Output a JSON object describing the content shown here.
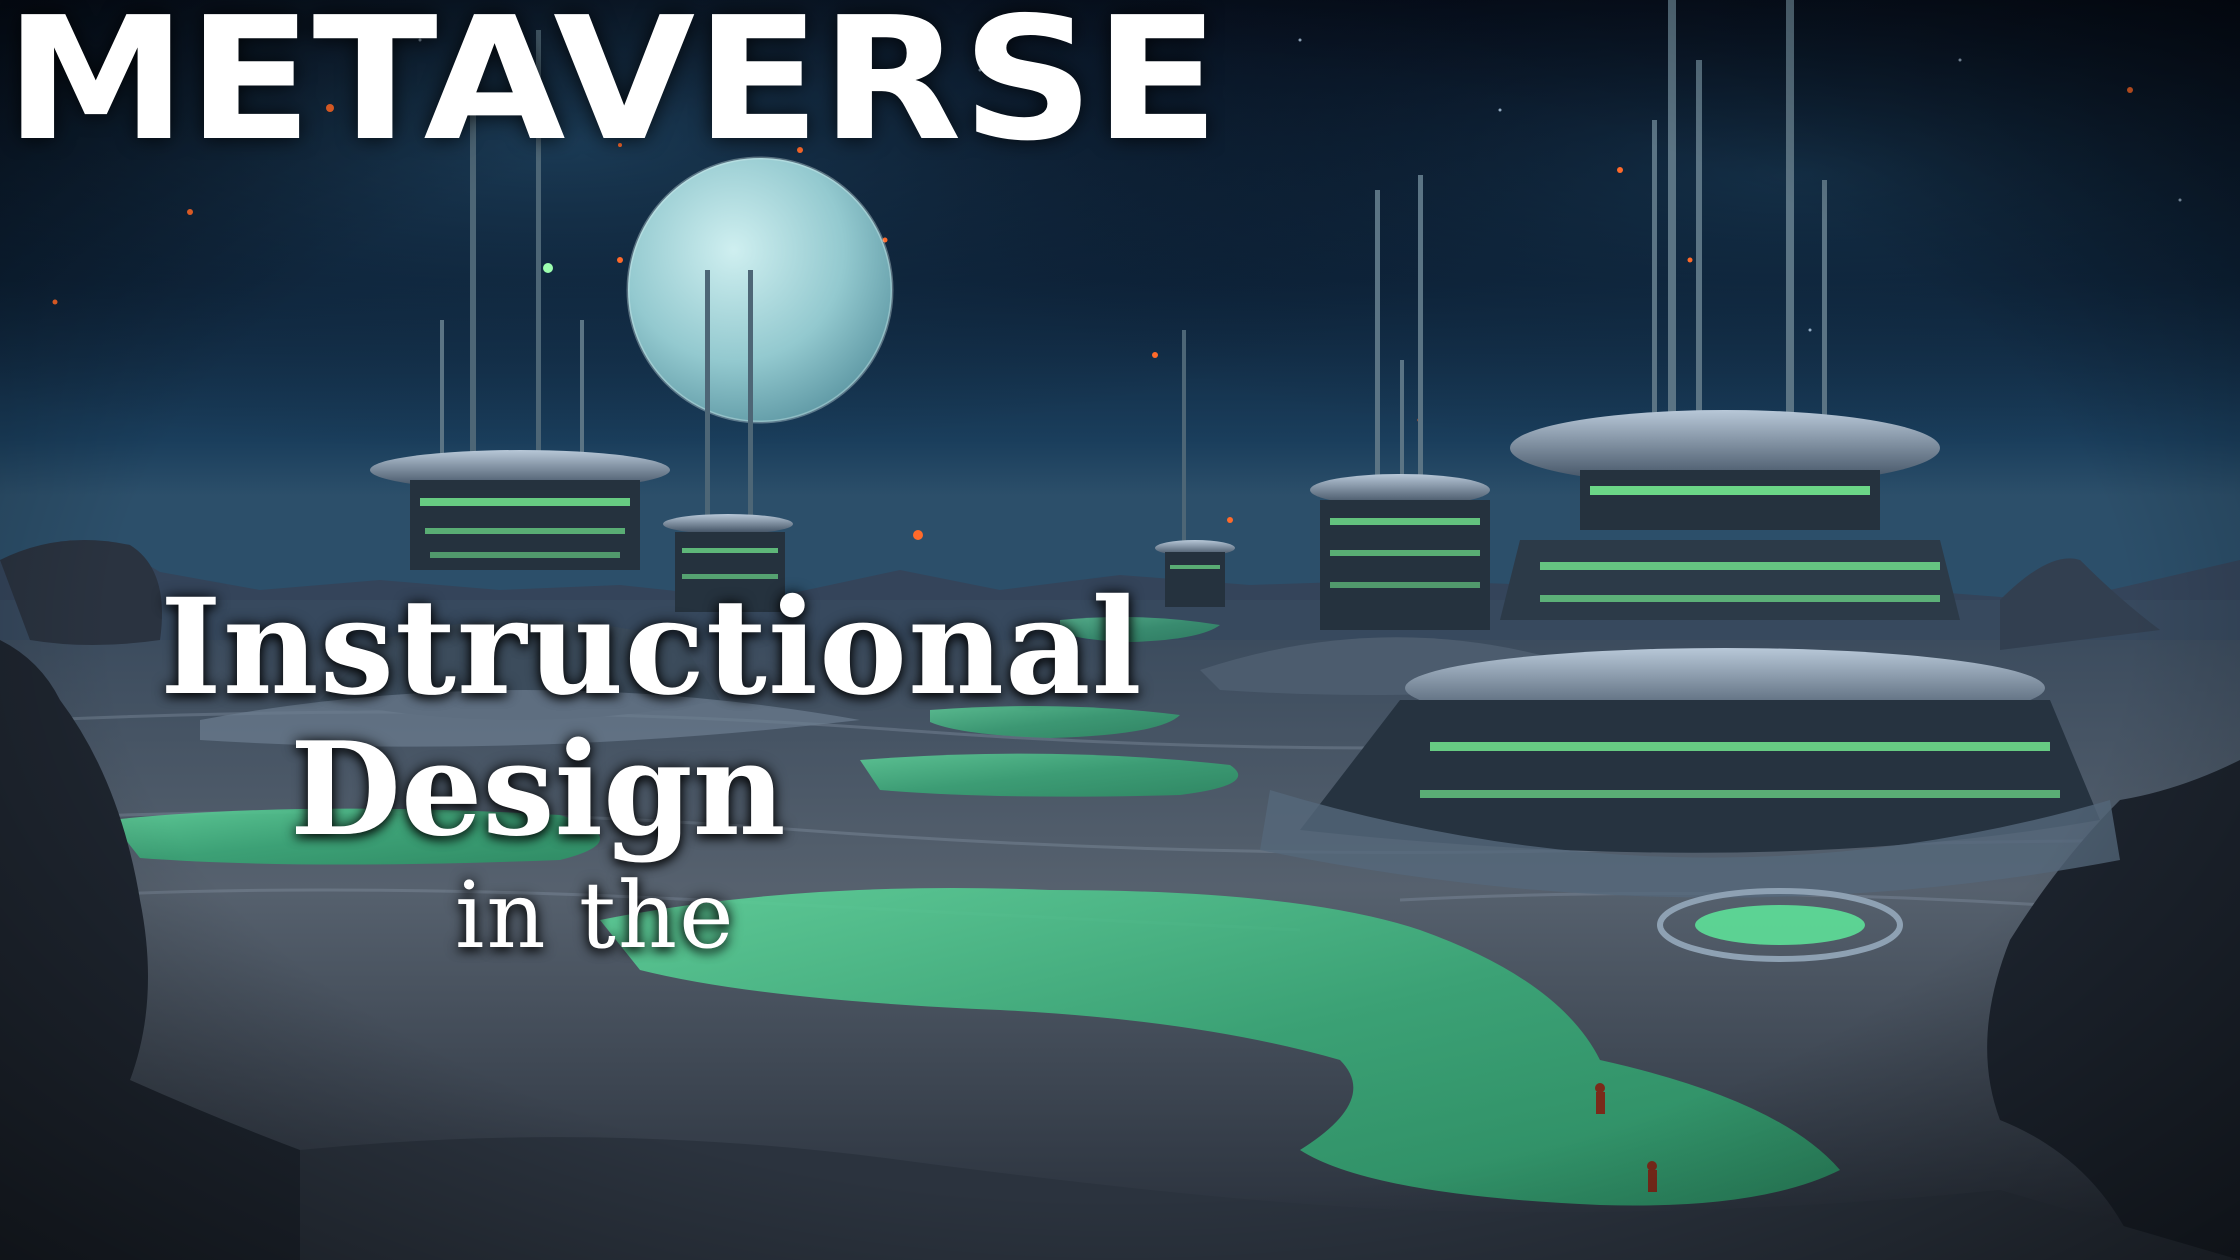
{
  "title": {
    "line1": "Instructional",
    "line2": "Design",
    "line3": "in the",
    "line4": "METAVERSE"
  },
  "colors": {
    "sky_dark": "#050c1c",
    "sky_mid": "#12304a",
    "planet": "#a8d8dc",
    "ground": "#4c5868",
    "pool_green": "#3fbf86",
    "glow_green": "#7dff9a",
    "text": "#ffffff"
  }
}
